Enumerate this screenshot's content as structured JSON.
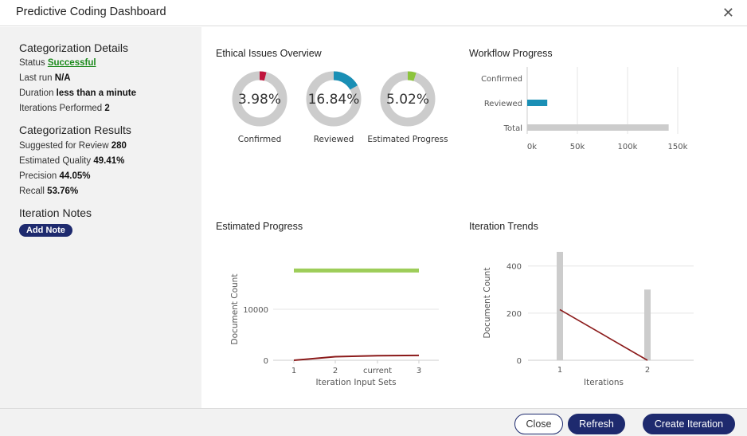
{
  "window": {
    "title": "Predictive Coding Dashboard"
  },
  "details": {
    "heading": "Categorization Details",
    "status_label": "Status",
    "status_value": "Successful",
    "lastrun_label": "Last run",
    "lastrun_value": "N/A",
    "duration_label": "Duration",
    "duration_value": "less than a minute",
    "iterations_label": "Iterations Performed",
    "iterations_value": "2"
  },
  "results": {
    "heading": "Categorization Results",
    "suggested_label": "Suggested for Review",
    "suggested_value": "280",
    "quality_label": "Estimated Quality",
    "quality_value": "49.41%",
    "precision_label": "Precision",
    "precision_value": "44.05%",
    "recall_label": "Recall",
    "recall_value": "53.76%"
  },
  "notes": {
    "heading": "Iteration Notes",
    "add_label": "Add Note"
  },
  "panels": {
    "ethical": "Ethical Issues Overview",
    "workflow": "Workflow Progress",
    "estimated": "Estimated Progress",
    "trends": "Iteration Trends"
  },
  "footer": {
    "close": "Close",
    "refresh": "Refresh",
    "create": "Create Iteration"
  },
  "colors": {
    "accent": "#1e2a6e",
    "confirmed": "#c0143c",
    "reviewed": "#1a8fb5",
    "estimated": "#8cc43c",
    "track": "#cccccc",
    "line": "#8b1a1a"
  },
  "chart_data": [
    {
      "type": "pie",
      "title": "Ethical Issues Overview",
      "donuts": [
        {
          "label": "Confirmed",
          "value": 3.98,
          "display": "3.98%",
          "color": "#c0143c"
        },
        {
          "label": "Reviewed",
          "value": 16.84,
          "display": "16.84%",
          "color": "#1a8fb5"
        },
        {
          "label": "Estimated Progress",
          "value": 5.02,
          "display": "5.02%",
          "color": "#8cc43c"
        }
      ]
    },
    {
      "type": "bar",
      "orientation": "horizontal",
      "title": "Workflow Progress",
      "categories": [
        "Confirmed",
        "Reviewed",
        "Total"
      ],
      "values": [
        1300,
        20000,
        141000
      ],
      "colors": [
        "#c0143c",
        "#1a8fb5",
        "#cccccc"
      ],
      "xlim": [
        0,
        150000
      ],
      "xticks": [
        "0k",
        "50k",
        "100k",
        "150k"
      ],
      "xtick_values": [
        0,
        50000,
        100000,
        150000
      ]
    },
    {
      "type": "line",
      "title": "Estimated Progress",
      "xlabel": "Iteration Input Sets",
      "ylabel": "Document Count",
      "categories": [
        "1",
        "2",
        "current",
        "3"
      ],
      "values": [
        0,
        700,
        900,
        950
      ],
      "target_value": 17600,
      "yticks": [
        0,
        10000
      ],
      "ylim": [
        0,
        20000
      ]
    },
    {
      "type": "bar",
      "title": "Iteration Trends",
      "xlabel": "Iterations",
      "ylabel": "Document Count",
      "categories": [
        "1",
        "2"
      ],
      "bar_values": [
        460,
        300
      ],
      "line_values": [
        215,
        0
      ],
      "yticks": [
        0,
        200,
        400
      ],
      "ylim": [
        0,
        470
      ]
    }
  ]
}
